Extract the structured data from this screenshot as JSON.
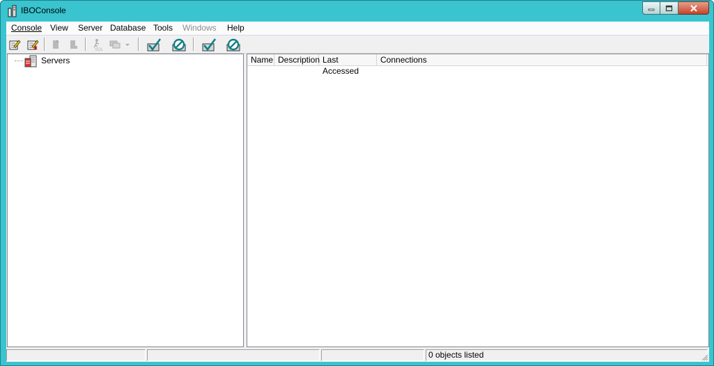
{
  "window": {
    "title": "IBOConsole",
    "colors": {
      "frame": "#39c4cf",
      "close": "#c8432a",
      "check_teal": "#0f7f86"
    }
  },
  "menu": {
    "items": [
      {
        "label": "Console",
        "enabled": true
      },
      {
        "label": "View",
        "enabled": true
      },
      {
        "label": "Server",
        "enabled": true
      },
      {
        "label": "Database",
        "enabled": true
      },
      {
        "label": "Tools",
        "enabled": true
      },
      {
        "label": "Windows",
        "enabled": false
      },
      {
        "label": "Help",
        "enabled": true
      }
    ]
  },
  "toolbar": {
    "buttons": [
      {
        "icon": "register-server-icon",
        "enabled": true
      },
      {
        "icon": "unregister-server-icon",
        "enabled": true
      },
      {
        "icon": "database-connect-icon",
        "enabled": false
      },
      {
        "icon": "database-disconnect-icon",
        "enabled": false
      },
      {
        "icon": "sql-icon",
        "enabled": false
      },
      {
        "icon": "windows-dropdown-icon",
        "enabled": false
      },
      {
        "icon": "server-login-icon",
        "enabled": true
      },
      {
        "icon": "server-logout-icon",
        "enabled": true
      },
      {
        "icon": "database-login-icon",
        "enabled": true
      },
      {
        "icon": "database-logout-icon",
        "enabled": true
      }
    ]
  },
  "tree": {
    "root": {
      "label": "Servers",
      "icon": "servers-icon"
    }
  },
  "list": {
    "columns": [
      "Name",
      "Description",
      "Last Accessed",
      "Connections"
    ],
    "rows": []
  },
  "status": {
    "panels": [
      "",
      "",
      "",
      "0 objects listed"
    ]
  }
}
